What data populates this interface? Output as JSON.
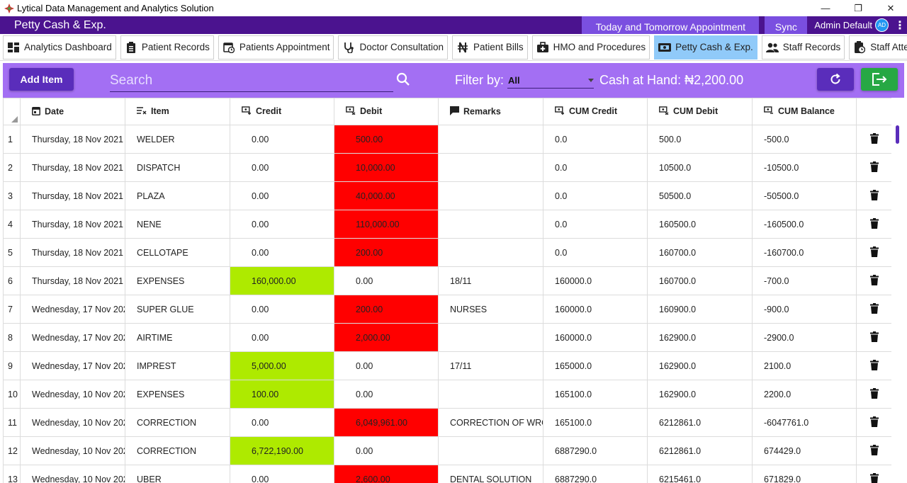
{
  "window": {
    "title": "Lytical Data Management and Analytics Solution"
  },
  "appbar": {
    "page_title": "Petty Cash & Exp.",
    "appointments_label": "Today and Tomorrow Appointment",
    "sync_label": "Sync",
    "user_name": "Admin Default",
    "avatar_initials": "AD"
  },
  "tabs": [
    {
      "label": "Analytics Dashboard",
      "icon": "dashboard-icon"
    },
    {
      "label": "Patient Records",
      "icon": "clipboard-icon"
    },
    {
      "label": "Patients Appointment",
      "icon": "calendar-clock-icon"
    },
    {
      "label": "Doctor Consultation",
      "icon": "stethoscope-icon"
    },
    {
      "label": "Patient Bills",
      "icon": "naira-icon"
    },
    {
      "label": "HMO and Procedures",
      "icon": "medical-bag-icon"
    },
    {
      "label": "Petty Cash & Exp.",
      "icon": "cash-icon",
      "active": true
    },
    {
      "label": "Staff Records",
      "icon": "people-icon"
    },
    {
      "label": "Staff Attendance",
      "icon": "clock-badge-icon"
    }
  ],
  "toolbar": {
    "add_label": "Add Item",
    "search_placeholder": "Search",
    "filter_label": "Filter by:",
    "filter_value": "All",
    "cash_label": "Cash at Hand: ₦2,200.00"
  },
  "table": {
    "headers": {
      "date": "Date",
      "item": "Item",
      "credit": "Credit",
      "debit": "Debit",
      "remarks": "Remarks",
      "cum_credit": "CUM Credit",
      "cum_debit": "CUM Debit",
      "cum_balance": "CUM Balance"
    },
    "rows": [
      {
        "n": "1",
        "date": "Thursday, 18 Nov 2021",
        "item": "WELDER",
        "credit": "0.00",
        "debit": "500.00",
        "remarks": "",
        "cum_credit": "0.0",
        "cum_debit": "500.0",
        "cum_balance": "-500.0",
        "type": "debit"
      },
      {
        "n": "2",
        "date": "Thursday, 18 Nov 2021",
        "item": "DISPATCH",
        "credit": "0.00",
        "debit": "10,000.00",
        "remarks": "",
        "cum_credit": "0.0",
        "cum_debit": "10500.0",
        "cum_balance": "-10500.0",
        "type": "debit"
      },
      {
        "n": "3",
        "date": "Thursday, 18 Nov 2021",
        "item": "PLAZA",
        "credit": "0.00",
        "debit": "40,000.00",
        "remarks": "",
        "cum_credit": "0.0",
        "cum_debit": "50500.0",
        "cum_balance": "-50500.0",
        "type": "debit"
      },
      {
        "n": "4",
        "date": "Thursday, 18 Nov 2021",
        "item": "NENE",
        "credit": "0.00",
        "debit": "110,000.00",
        "remarks": "",
        "cum_credit": "0.0",
        "cum_debit": "160500.0",
        "cum_balance": "-160500.0",
        "type": "debit"
      },
      {
        "n": "5",
        "date": "Thursday, 18 Nov 2021",
        "item": "CELLOTAPE",
        "credit": "0.00",
        "debit": "200.00",
        "remarks": "",
        "cum_credit": "0.0",
        "cum_debit": "160700.0",
        "cum_balance": "-160700.0",
        "type": "debit"
      },
      {
        "n": "6",
        "date": "Thursday, 18 Nov 2021",
        "item": "EXPENSES",
        "credit": "160,000.00",
        "debit": "0.00",
        "remarks": "18/11",
        "cum_credit": "160000.0",
        "cum_debit": "160700.0",
        "cum_balance": "-700.0",
        "type": "credit"
      },
      {
        "n": "7",
        "date": "Wednesday, 17 Nov 202",
        "item": "SUPER GLUE",
        "credit": "0.00",
        "debit": "200.00",
        "remarks": "NURSES",
        "cum_credit": "160000.0",
        "cum_debit": "160900.0",
        "cum_balance": "-900.0",
        "type": "debit"
      },
      {
        "n": "8",
        "date": "Wednesday, 17 Nov 202",
        "item": "AIRTIME",
        "credit": "0.00",
        "debit": "2,000.00",
        "remarks": "",
        "cum_credit": "160000.0",
        "cum_debit": "162900.0",
        "cum_balance": "-2900.0",
        "type": "debit"
      },
      {
        "n": "9",
        "date": "Wednesday, 17 Nov 202",
        "item": "IMPREST",
        "credit": "5,000.00",
        "debit": "0.00",
        "remarks": "17/11",
        "cum_credit": "165000.0",
        "cum_debit": "162900.0",
        "cum_balance": "2100.0",
        "type": "credit"
      },
      {
        "n": "10",
        "date": "Wednesday, 10 Nov 202",
        "item": "EXPENSES",
        "credit": "100.00",
        "debit": "0.00",
        "remarks": "",
        "cum_credit": "165100.0",
        "cum_debit": "162900.0",
        "cum_balance": "2200.0",
        "type": "credit"
      },
      {
        "n": "11",
        "date": "Wednesday, 10 Nov 202",
        "item": "CORRECTION",
        "credit": "0.00",
        "debit": "6,049,961.00",
        "remarks": "CORRECTION OF WRON",
        "cum_credit": "165100.0",
        "cum_debit": "6212861.0",
        "cum_balance": "-6047761.0",
        "type": "debit"
      },
      {
        "n": "12",
        "date": "Wednesday, 10 Nov 202",
        "item": "CORRECTION",
        "credit": "6,722,190.00",
        "debit": "0.00",
        "remarks": "",
        "cum_credit": "6887290.0",
        "cum_debit": "6212861.0",
        "cum_balance": "674429.0",
        "type": "credit"
      },
      {
        "n": "13",
        "date": "Wednesday, 10 Nov 202",
        "item": "UBER",
        "credit": "0.00",
        "debit": "2,600.00",
        "remarks": "DENTAL SOLUTION",
        "cum_credit": "6887290.0",
        "cum_debit": "6215461.0",
        "cum_balance": "671829.0",
        "type": "debit"
      }
    ]
  },
  "colors": {
    "header": "#4b138f",
    "toolbar": "#a36ff3",
    "credit_fill": "#aeea00",
    "debit_fill": "#ff0000",
    "active_tab": "#90caf9",
    "export_button": "#27a844"
  }
}
